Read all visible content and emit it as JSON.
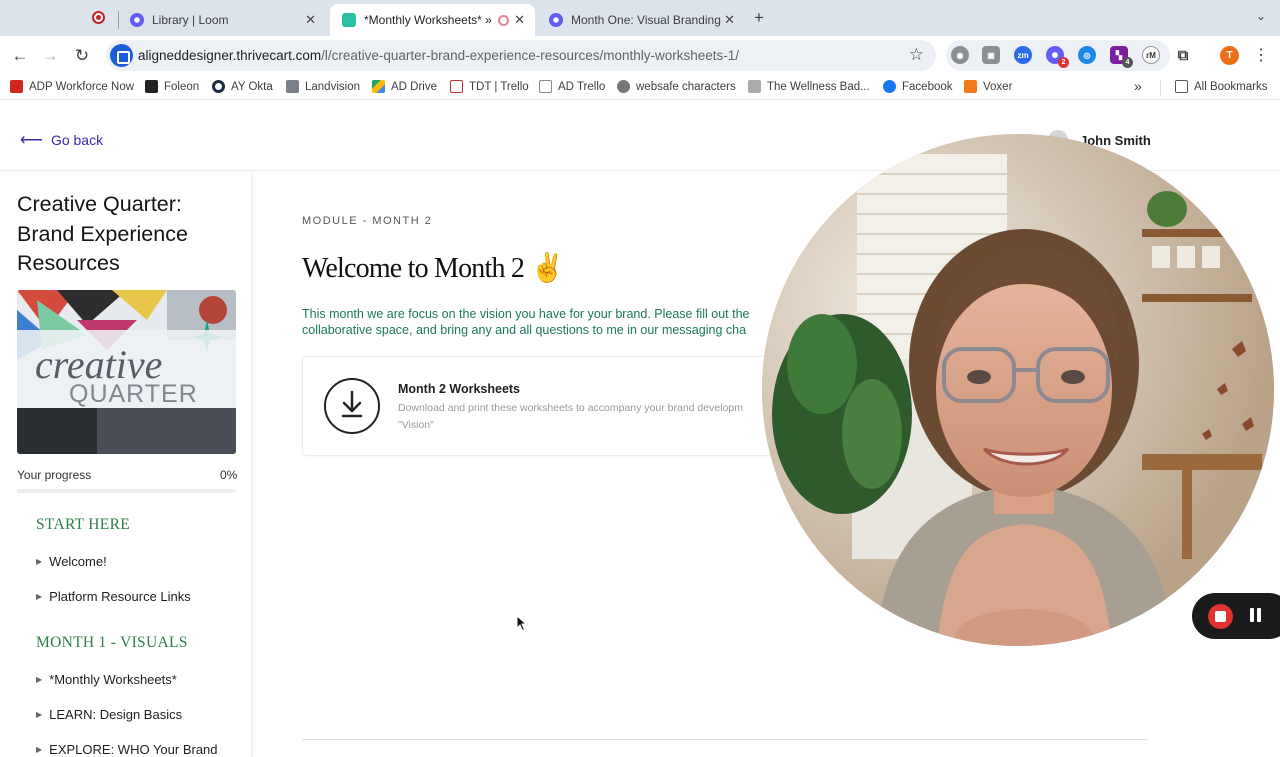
{
  "browser": {
    "tabs": [
      {
        "label": "",
        "icon": "recording-icon"
      },
      {
        "label": "Library | Loom",
        "icon": "loom-icon"
      },
      {
        "label": "*Monthly Worksheets* »",
        "icon": "thrivecart-icon"
      },
      {
        "label": "Month One: Visual Branding",
        "icon": "loom-icon"
      }
    ],
    "url_host": "aligneddesigner.thrivecart.com",
    "url_path": "/l/creative-quarter-brand-experience-resources/monthly-worksheets-1/",
    "extensions": [
      {
        "icon": "extension-grey-icon",
        "badge": ""
      },
      {
        "icon": "camera-icon",
        "badge": ""
      },
      {
        "icon": "zoom-icon",
        "badge": ""
      },
      {
        "icon": "loom-extension-icon",
        "badge": "2"
      },
      {
        "icon": "blue-circle-icon",
        "badge": ""
      },
      {
        "icon": "purple-square-icon",
        "badge": "4"
      },
      {
        "icon": "rm-icon",
        "badge": ""
      },
      {
        "icon": "puzzle-icon",
        "badge": ""
      }
    ],
    "profile_initial": "T",
    "bookmarks": [
      "ADP Workforce Now",
      "Foleon",
      "AY Okta",
      "Landvision",
      "AD Drive",
      "TDT | Trello",
      "AD Trello",
      "websafe characters",
      "The Wellness Bad...",
      "Facebook",
      "Voxer"
    ],
    "all_bookmarks": "All Bookmarks"
  },
  "header": {
    "go_back": "Go back",
    "user_name": "John Smith"
  },
  "sidebar": {
    "course_title": "Creative Quarter: Brand Experience Resources",
    "thumbnail_text_1": "creative",
    "thumbnail_text_2": "QUARTER",
    "progress_label": "Your progress",
    "progress_pct": "0%",
    "progress_value": 0,
    "sections": [
      {
        "title": "START HERE",
        "lessons": [
          "Welcome!",
          "Platform Resource Links"
        ]
      },
      {
        "title": "MONTH 1 - VISUALS",
        "lessons": [
          "*Monthly Worksheets*",
          "LEARN: Design Basics",
          "EXPLORE: WHO Your Brand"
        ]
      }
    ]
  },
  "main": {
    "module_label": "MODULE - MONTH 2",
    "welcome_title": "Welcome to Month 2 ✌️",
    "intro_line_1": "This month we are focus on the vision you have for your brand. Please fill out the",
    "intro_line_2": "collaborative space, and bring any and all questions to me in our messaging cha",
    "card": {
      "title": "Month 2 Worksheets",
      "description_line_1": "Download and print these worksheets to accompany your brand developm",
      "description_line_2": "\"Vision\""
    }
  },
  "colors": {
    "accent_purple": "#3b2aa7",
    "section_green": "#2e7d4a",
    "intro_green": "#1d7a55",
    "progress_fill": "#9d82d6",
    "record_red": "#e0332f"
  }
}
